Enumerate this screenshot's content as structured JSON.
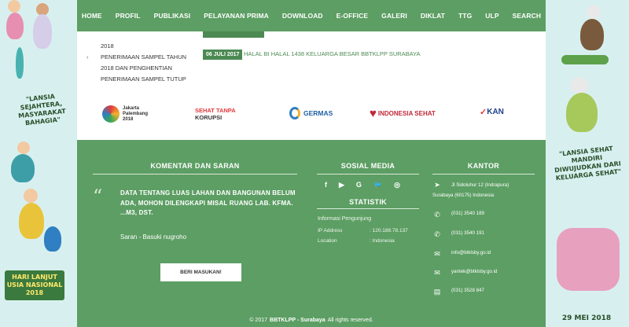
{
  "nav": {
    "items": [
      "HOME",
      "PROFIL",
      "PUBLIKASI",
      "PELAYANAN PRIMA",
      "DOWNLOAD",
      "E-OFFICE",
      "GALERI",
      "DIKLAT",
      "TTG",
      "ULP",
      "SEARCH"
    ]
  },
  "news": {
    "list": [
      "2018",
      "PENERIMAAN SAMPEL TAHUN",
      "2018 DAN PENGHENTIAN",
      "PENERIMAAN SAMPEL TUTUP"
    ],
    "date": "06 JULI 2017",
    "headline": "HALAL BI HALAL 1438 KELUARGA BESAR BBTKLPP SURABAYA"
  },
  "logos": {
    "asian_games": [
      "Jakarta",
      "Palembang",
      "2018"
    ],
    "sehat_tanpa": "SEHAT TANPA",
    "korupsi": "KORUPSI",
    "germas": "GERMAS",
    "indonesia_sehat": "INDONESIA SEHAT",
    "kan": "KAN"
  },
  "komentar": {
    "title": "KOMENTAR DAN SARAN",
    "text": "DATA TENTANG LUAS LAHAN DAN BANGUNAN BELUM ADA, MOHON DILENGKAPI MISAL RUANG LAB. KFMA. ...M3, DST.",
    "author": "Saran - Basuki nugroho",
    "button": "BERI MASUKAN!"
  },
  "social": {
    "title": "SOSIAL MEDIA",
    "icons": [
      "f",
      "▶",
      "G",
      "🐦",
      "◎"
    ]
  },
  "statistik": {
    "title": "STATISTIK",
    "subtitle": "Informasi Pengunjung",
    "ip_label": "IP Address",
    "ip_value": ": 120.188.78.137",
    "loc_label": "Location",
    "loc_value": ": Indonesia"
  },
  "kantor": {
    "title": "KANTOR",
    "address1": "Jl Sidoluhur 12 (Indrapura)",
    "address2": "Surabaya (60175) Indonesia",
    "phone1": "(031) 3540 189",
    "phone2": "(031) 3540 191",
    "email1": "info@btklsby.go.id",
    "email2": "yantek@btklsby.go.id",
    "fax": "(031) 3528 847"
  },
  "footer": {
    "copy_prefix": "© 2017",
    "copy_brand": "BBTKLPP - Surabaya",
    "copy_suffix": "All rights reserved."
  },
  "banner_left": {
    "text1": "\"LANSIA SEJAHTERA, MASYARAKAT BAHAGIA\"",
    "badge": "HARI LANJUT USIA NASIONAL 2018"
  },
  "banner_right": {
    "text1": "\"LANSIA SEHAT MANDIRI DIWUJUDKAN DARI KELUARGA SEHAT\"",
    "date": "29 MEI 2018"
  },
  "colors": {
    "green": "#5c9e63",
    "dark_green": "#4b8a52"
  }
}
